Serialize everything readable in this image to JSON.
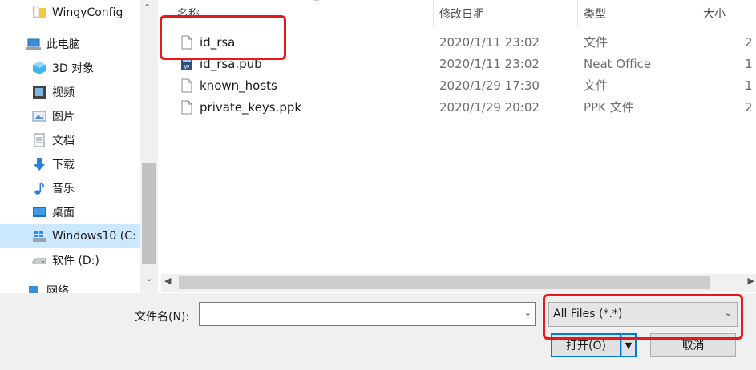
{
  "nav": {
    "items": [
      {
        "label": "WingyConfig",
        "icon": "folder-icon"
      },
      {
        "label": "此电脑",
        "icon": "computer-icon"
      },
      {
        "label": "3D 对象",
        "icon": "3d-objects-icon"
      },
      {
        "label": "视频",
        "icon": "video-icon"
      },
      {
        "label": "图片",
        "icon": "pictures-icon"
      },
      {
        "label": "文档",
        "icon": "documents-icon"
      },
      {
        "label": "下载",
        "icon": "download-icon"
      },
      {
        "label": "音乐",
        "icon": "music-icon"
      },
      {
        "label": "桌面",
        "icon": "desktop-icon"
      },
      {
        "label": "Windows10 (C:",
        "icon": "windows-drive-icon",
        "selected": true
      },
      {
        "label": "软件 (D:)",
        "icon": "drive-icon"
      },
      {
        "label": "网络",
        "icon": "network-icon"
      }
    ]
  },
  "columns": {
    "name": "名称",
    "date": "修改日期",
    "type": "类型",
    "size": "大小"
  },
  "files": [
    {
      "name": "id_rsa",
      "date": "2020/1/11 23:02",
      "type": "文件",
      "size": "2",
      "icon": "file-icon"
    },
    {
      "name": "id_rsa.pub",
      "date": "2020/1/11 23:02",
      "type": "Neat Office",
      "size": "1",
      "icon": "neat-office-file-icon"
    },
    {
      "name": "known_hosts",
      "date": "2020/1/29 17:30",
      "type": "文件",
      "size": "1",
      "icon": "file-icon"
    },
    {
      "name": "private_keys.ppk",
      "date": "2020/1/29 20:02",
      "type": "PPK 文件",
      "size": "2",
      "icon": "file-icon"
    }
  ],
  "footer": {
    "filename_label": "文件名(N):",
    "filename_value": "",
    "filter_value": "All Files (*.*)",
    "open_label": "打开(O)",
    "cancel_label": "取消"
  },
  "colors": {
    "highlight": "#e8191a",
    "selection": "#cce8ff",
    "accent": "#0078d7"
  }
}
